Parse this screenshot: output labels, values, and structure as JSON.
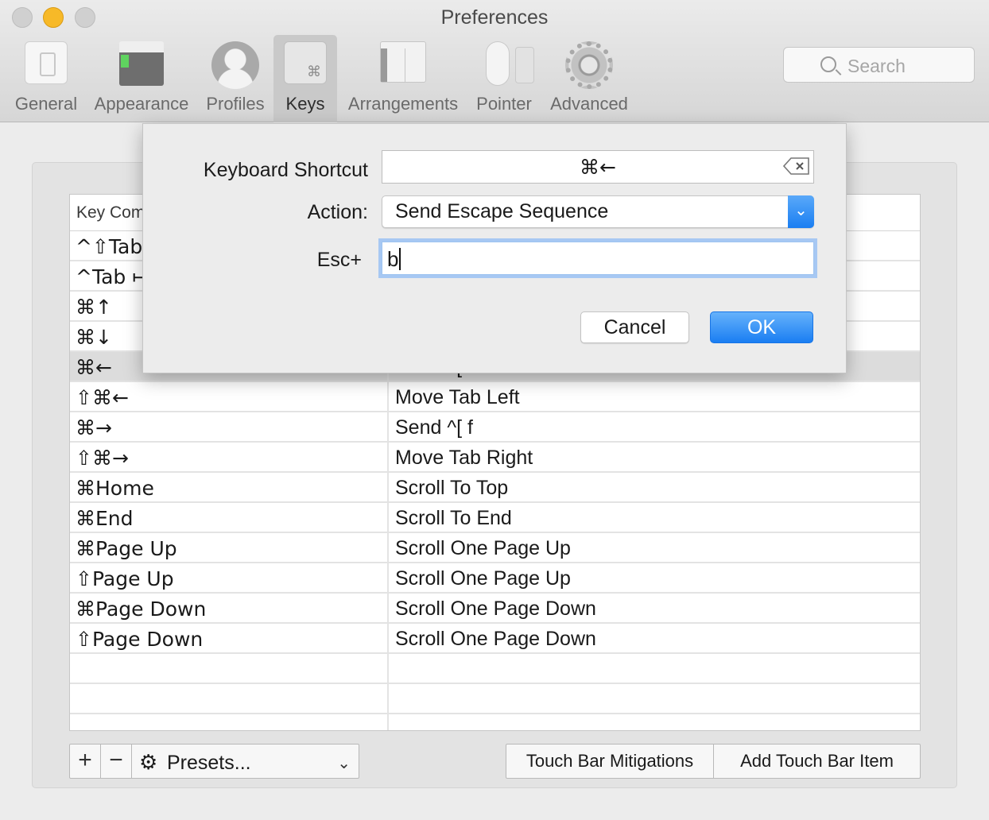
{
  "window": {
    "title": "Preferences"
  },
  "toolbar": {
    "tabs": [
      {
        "label": "General",
        "icon": "general-icon"
      },
      {
        "label": "Appearance",
        "icon": "appearance-icon"
      },
      {
        "label": "Profiles",
        "icon": "profiles-icon"
      },
      {
        "label": "Keys",
        "icon": "keys-icon",
        "selected": true
      },
      {
        "label": "Arrangements",
        "icon": "arrangements-icon"
      },
      {
        "label": "Pointer",
        "icon": "pointer-icon"
      },
      {
        "label": "Advanced",
        "icon": "advanced-icon"
      }
    ],
    "keys_glyph": "⌘",
    "search_placeholder": "Search"
  },
  "table": {
    "header": {
      "col1": "Key Combination",
      "col2": ""
    },
    "rows": [
      {
        "key": "^⇧Tab",
        "action": ""
      },
      {
        "key": "^Tab ↦",
        "action": ""
      },
      {
        "key": "⌘↑",
        "action": ""
      },
      {
        "key": "⌘↓",
        "action": ""
      },
      {
        "key": "⌘←",
        "action": "Send ^[ b",
        "selected": true
      },
      {
        "key": "⇧⌘←",
        "action": "Move Tab Left"
      },
      {
        "key": "⌘→",
        "action": "Send ^[ f"
      },
      {
        "key": "⇧⌘→",
        "action": "Move Tab Right"
      },
      {
        "key": "⌘Home",
        "action": "Scroll To Top"
      },
      {
        "key": "⌘End",
        "action": "Scroll To End"
      },
      {
        "key": "⌘Page Up",
        "action": "Scroll One Page Up"
      },
      {
        "key": "⇧Page Up",
        "action": "Scroll One Page Up"
      },
      {
        "key": "⌘Page Down",
        "action": "Scroll One Page Down"
      },
      {
        "key": "⇧Page Down",
        "action": "Scroll One Page Down"
      },
      {
        "key": "",
        "action": ""
      },
      {
        "key": "",
        "action": ""
      },
      {
        "key": "",
        "action": ""
      }
    ]
  },
  "bottom_bar": {
    "add": "+",
    "remove": "−",
    "presets_label": "Presets...",
    "gear_glyph": "⚙",
    "chevron": "⌄",
    "touch_bar_mitigations": "Touch Bar Mitigations",
    "add_touch_bar_item": "Add Touch Bar Item"
  },
  "sheet": {
    "shortcut_label": "Keyboard Shortcut",
    "shortcut_value": "⌘←",
    "action_label": "Action:",
    "action_value": "Send Escape Sequence",
    "action_chevron": "⌄",
    "esc_label": "Esc+",
    "esc_value": "b",
    "cancel_label": "Cancel",
    "ok_label": "OK"
  },
  "colors": {
    "accent": "#1a7ef2",
    "minimize": "#f7b928",
    "selected_row": "#dcdcdc"
  }
}
